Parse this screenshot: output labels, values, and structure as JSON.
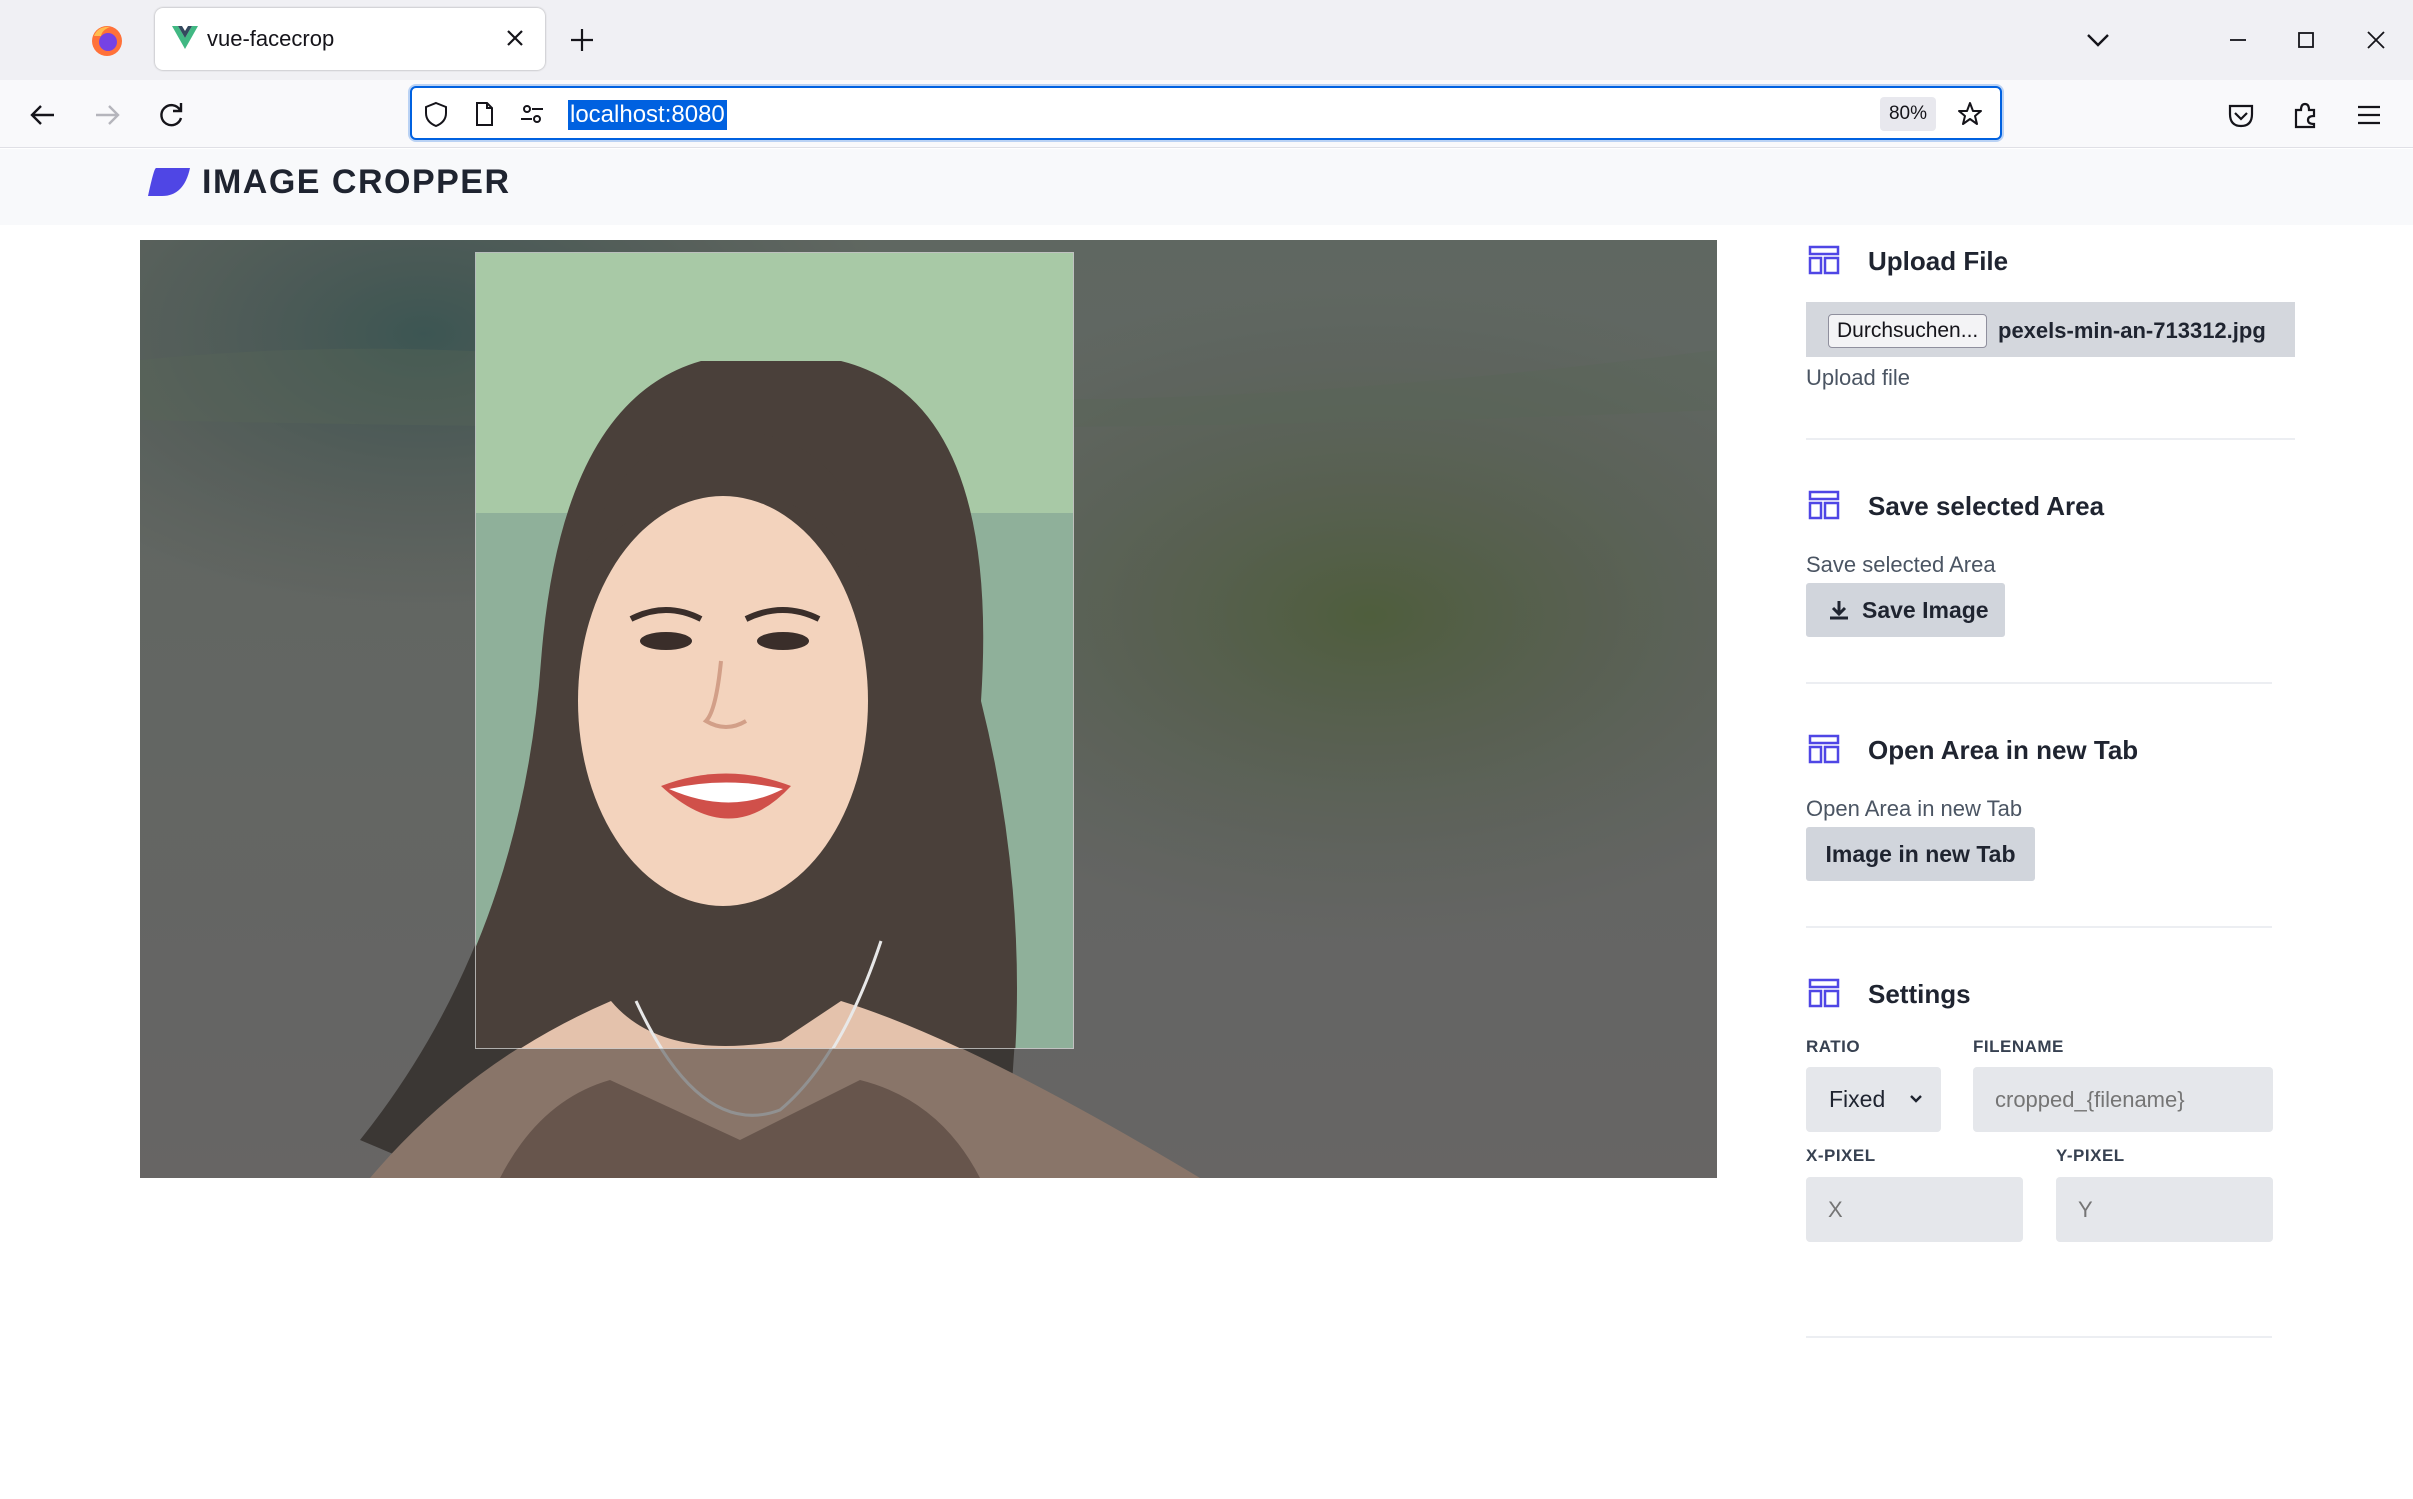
{
  "browser": {
    "tab_title": "vue-facecrop",
    "url": "localhost:8080",
    "zoom": "80%"
  },
  "app": {
    "title": "IMAGE CROPPER"
  },
  "upload": {
    "title": "Upload File",
    "browse_label": "Durchsuchen...",
    "file_name": "pexels-min-an-713312.jpg",
    "caption": "Upload file"
  },
  "save": {
    "title": "Save selected Area",
    "caption": "Save selected Area",
    "button_label": "Save Image"
  },
  "open_tab": {
    "title": "Open Area in new Tab",
    "caption": "Open Area in new Tab",
    "button_label": "Image in new Tab"
  },
  "settings": {
    "title": "Settings",
    "ratio_label": "RATIO",
    "ratio_value": "Fixed",
    "filename_label": "FILENAME",
    "filename_placeholder": "cropped_{filename}",
    "x_label": "X-PIXEL",
    "x_placeholder": "X",
    "y_label": "Y-PIXEL",
    "y_placeholder": "Y"
  },
  "colors": {
    "accent": "#4f46e5",
    "url_highlight": "#0061e0",
    "button_bg": "#d1d5dc"
  }
}
